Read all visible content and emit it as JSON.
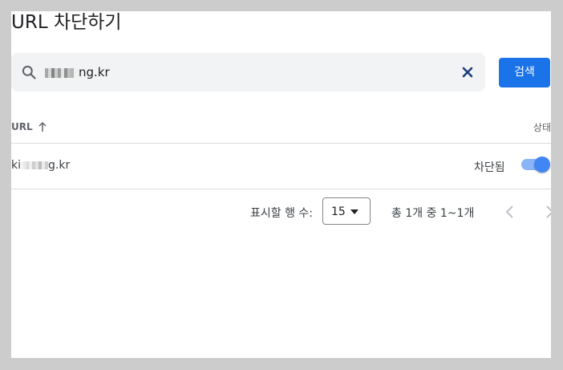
{
  "dialog": {
    "title": "URL 차단하기"
  },
  "search": {
    "value_suffix": "ng.kr",
    "button_label": "검색"
  },
  "table": {
    "columns": {
      "url": "URL",
      "status": "상태"
    },
    "rows": [
      {
        "url_prefix": "ki",
        "url_suffix": "g.kr",
        "status": "차단됨",
        "toggle_on": true
      }
    ]
  },
  "pagination": {
    "rows_per_page_label": "표시할 행 수:",
    "rows_per_page": "15",
    "range": "총 1개 중 1~1개"
  },
  "colors": {
    "primary": "#1a73e8",
    "toggle_track": "#8ab4f8",
    "toggle_thumb": "#4285f4",
    "search_bg": "#f1f3f4"
  },
  "icons": [
    "search-icon",
    "close-icon",
    "arrow-up-icon",
    "dropdown-arrow-icon",
    "chevron-left-icon",
    "chevron-right-icon"
  ]
}
